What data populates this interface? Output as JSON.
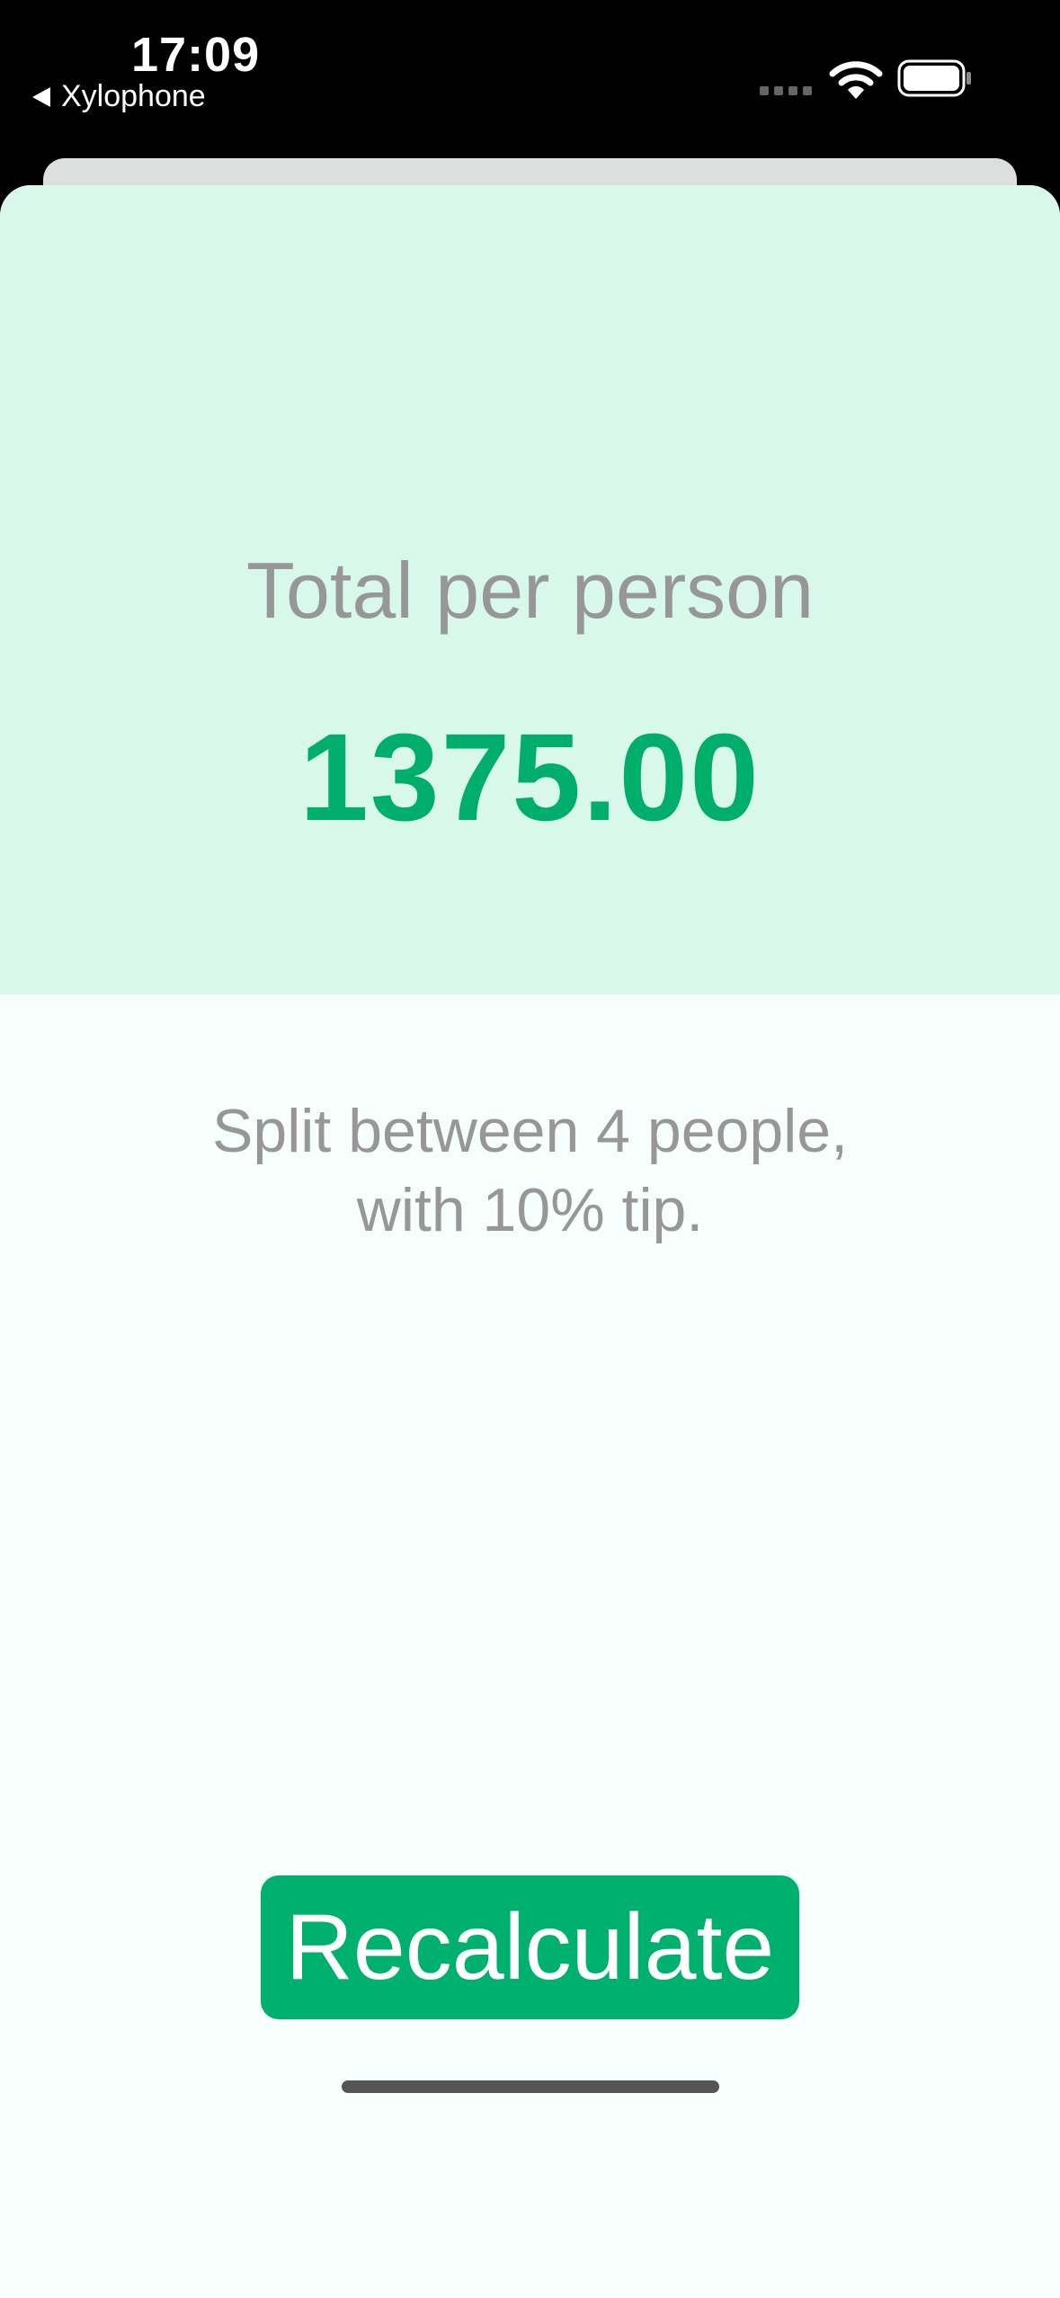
{
  "status_bar": {
    "time": "17:09",
    "back_label": "Xylophone",
    "icons": [
      "signal-dots-icon",
      "wifi-icon",
      "battery-icon"
    ]
  },
  "result": {
    "label": "Total per person",
    "value": "1375.00"
  },
  "settings": {
    "line1": "Split between 4 people,",
    "line2": "with 10% tip."
  },
  "actions": {
    "recalculate_label": "Recalculate"
  },
  "colors": {
    "accent": "#00B06E",
    "result_background": "#D7F8EA",
    "page_background": "#F6FFFC",
    "secondary_text": "#979797"
  }
}
